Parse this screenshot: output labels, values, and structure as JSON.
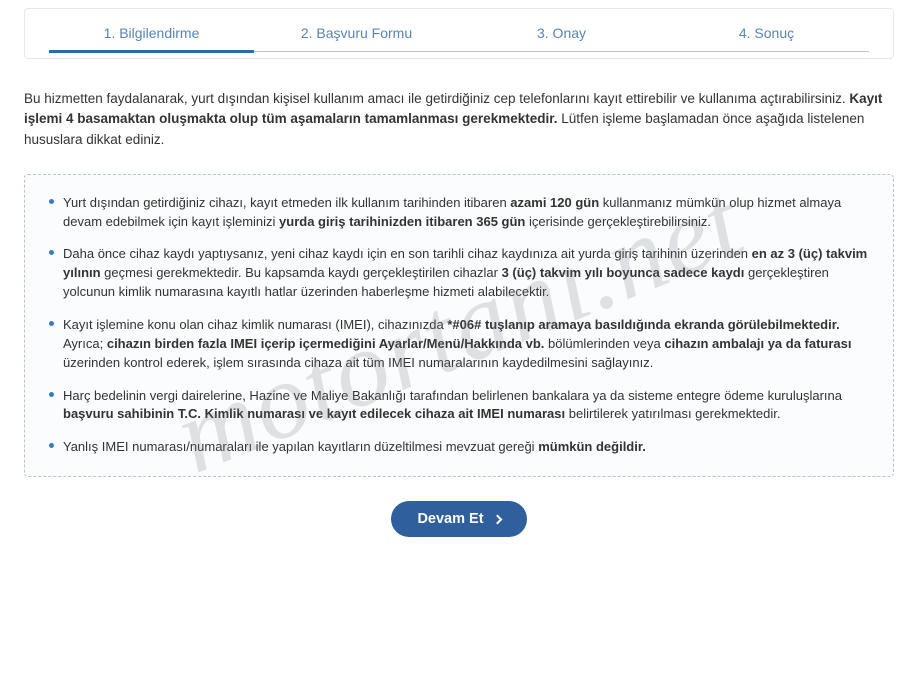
{
  "steps": {
    "s1": "1. Bilgilendirme",
    "s2": "2. Başvuru Formu",
    "s3": "3. Onay",
    "s4": "4. Sonuç"
  },
  "intro_html": "Bu hizmetten faydalanarak, yurt dışından kişisel kullanım amacı ile getirdiğiniz cep telefonlarını kayıt ettirebilir ve kullanıma açtırabilirsiniz. <b>Kayıt işlemi 4 basamaktan oluşmakta olup tüm aşamaların tamamlanması gerekmektedir.</b> Lütfen işleme başlamadan önce aşağıda listelenen hususlara dikkat ediniz.",
  "bullets": [
    "Yurt dışından getirdiğiniz cihazı, kayıt etmeden ilk kullanım tarihinden itibaren <b>azami 120 gün</b> kullanmanız mümkün olup hizmet almaya devam edebilmek için kayıt işleminizi <b>yurda giriş tarihinizden itibaren 365 gün</b> içerisinde gerçekleştirebilirsiniz.",
    "Daha önce cihaz kaydı yaptıysanız, yeni cihaz kaydı için en son tarihli cihaz kaydınıza ait yurda giriş tarihinin üzerinden <b>en az 3 (üç) takvim yılının</b> geçmesi gerekmektedir. Bu kapsamda kaydı gerçekleştirilen cihazlar <b>3 (üç) takvim yılı boyunca sadece kaydı</b> gerçekleştiren yolcunun kimlik numarasına kayıtlı hatlar üzerinden haberleşme hizmeti alabilecektir.",
    "Kayıt işlemine konu olan cihaz kimlik numarası (IMEI), cihazınızda <b>*#06# tuşlanıp aramaya basıldığında ekranda görülebilmektedir.</b> Ayrıca; <b>cihazın birden fazla IMEI içerip içermediğini Ayarlar/Menü/Hakkında vb.</b> bölümlerinden veya <b>cihazın ambalajı ya da faturası</b> üzerinden kontrol ederek, işlem sırasında cihaza ait tüm IMEI numaralarının kaydedilmesini sağlayınız.",
    "Harç bedelinin vergi dairelerine, Hazine ve Maliye Bakanlığı tarafından belirlenen bankalara ya da sisteme entegre ödeme kuruluşlarına <b>başvuru sahibinin T.C. Kimlik numarası ve kayıt edilecek cihaza ait IMEI numarası</b> belirtilerek yatırılması gerekmektedir.",
    "Yanlış IMEI numarası/numaraları ile yapılan kayıtların düzeltilmesi mevzuat gereği <b>mümkün değildir.</b>"
  ],
  "button": {
    "label": "Devam Et"
  },
  "watermark": "motortanı.net"
}
